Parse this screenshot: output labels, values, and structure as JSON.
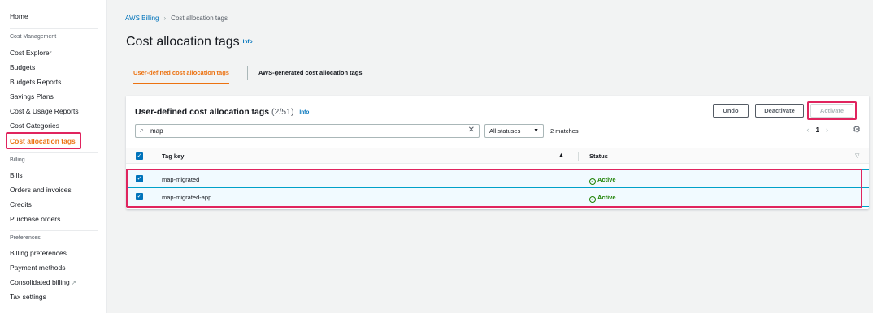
{
  "sidebar": {
    "home": "Home",
    "cost_management_heading": "Cost Management",
    "cost_management_items": [
      "Cost Explorer",
      "Budgets",
      "Budgets Reports",
      "Savings Plans",
      "Cost & Usage Reports",
      "Cost Categories",
      "Cost allocation tags"
    ],
    "billing_heading": "Billing",
    "billing_items": [
      "Bills",
      "Orders and invoices",
      "Credits",
      "Purchase orders"
    ],
    "preferences_heading": "Preferences",
    "preferences_items": [
      "Billing preferences",
      "Payment methods",
      "Consolidated billing",
      "Tax settings"
    ],
    "active_item": "Cost allocation tags"
  },
  "breadcrumb": {
    "parent": "AWS Billing",
    "current": "Cost allocation tags"
  },
  "page": {
    "title": "Cost allocation tags",
    "info": "Info"
  },
  "tabs": [
    {
      "label": "User-defined cost allocation tags",
      "active": true
    },
    {
      "label": "AWS-generated cost allocation tags",
      "active": false
    }
  ],
  "panel": {
    "title": "User-defined cost allocation tags",
    "count": "(2/51)",
    "info": "Info",
    "buttons": {
      "undo": "Undo",
      "deactivate": "Deactivate",
      "activate": "Activate"
    }
  },
  "filter": {
    "search_value": "map",
    "status_select": "All statuses",
    "matches": "2 matches"
  },
  "pagination": {
    "prev": "‹",
    "page": "1",
    "next": "›"
  },
  "table": {
    "columns": {
      "key": "Tag key",
      "status": "Status"
    },
    "rows": [
      {
        "key": "map-migrated",
        "status": "Active",
        "selected": true
      },
      {
        "key": "map-migrated-app",
        "status": "Active",
        "selected": true
      }
    ]
  },
  "icons": {
    "search": "search-icon",
    "clear": "close-icon",
    "caret": "caret-down-icon",
    "settings": "gear-icon",
    "sort": "sort-up-icon",
    "status": "check-circle-icon",
    "external": "external-link-icon"
  },
  "colors": {
    "accent": "#ec7211",
    "link": "#0073bb",
    "success": "#1d8102",
    "highlight": "#e0245e",
    "selected_row_bg": "#f1faff",
    "selected_row_border": "#00a1c9"
  }
}
